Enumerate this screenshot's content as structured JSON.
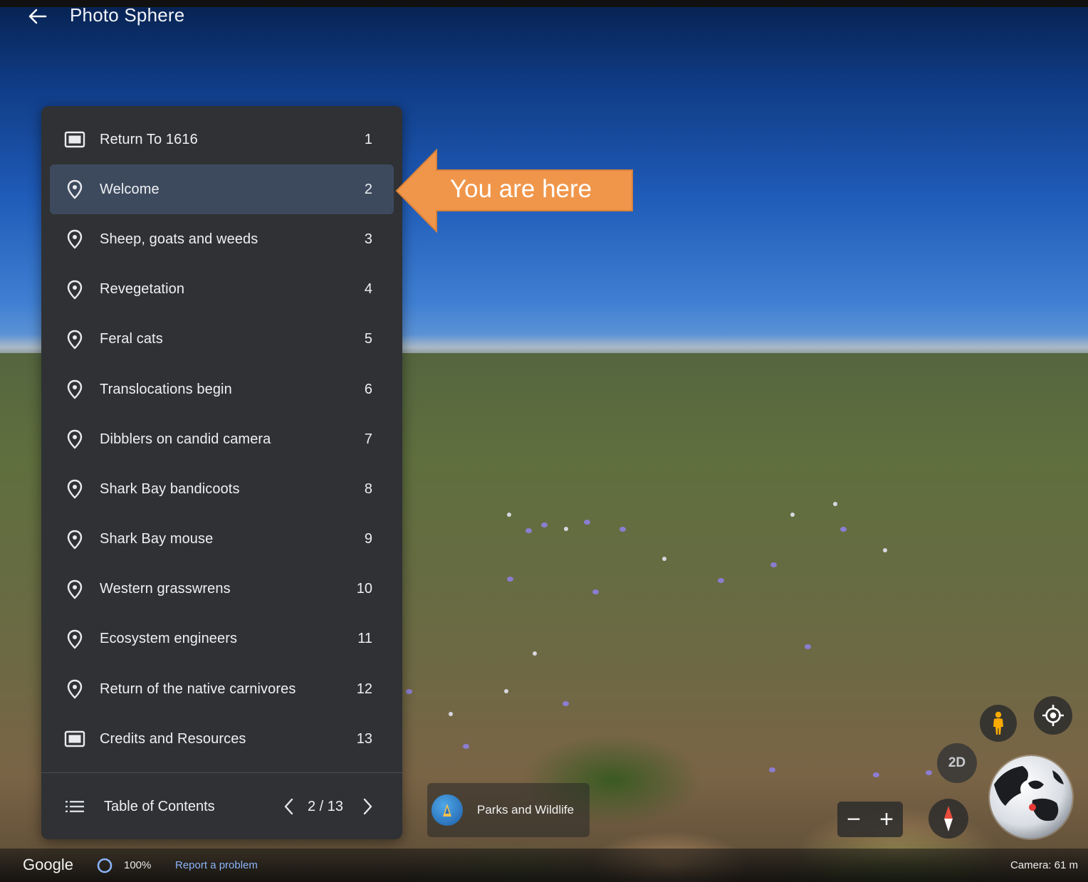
{
  "header": {
    "title": "Photo Sphere"
  },
  "toc": {
    "items": [
      {
        "label": "Return To 1616",
        "num": "1",
        "icon": "slide-icon",
        "active": false
      },
      {
        "label": "Welcome",
        "num": "2",
        "icon": "place-pin-icon",
        "active": true
      },
      {
        "label": "Sheep, goats and weeds",
        "num": "3",
        "icon": "place-pin-icon",
        "active": false
      },
      {
        "label": "Revegetation",
        "num": "4",
        "icon": "place-pin-icon",
        "active": false
      },
      {
        "label": "Feral cats",
        "num": "5",
        "icon": "place-pin-icon",
        "active": false
      },
      {
        "label": "Translocations begin",
        "num": "6",
        "icon": "place-pin-icon",
        "active": false
      },
      {
        "label": "Dibblers on candid camera",
        "num": "7",
        "icon": "place-pin-icon",
        "active": false
      },
      {
        "label": "Shark Bay bandicoots",
        "num": "8",
        "icon": "place-pin-icon",
        "active": false
      },
      {
        "label": "Shark Bay mouse",
        "num": "9",
        "icon": "place-pin-icon",
        "active": false
      },
      {
        "label": "Western grasswrens",
        "num": "10",
        "icon": "place-pin-icon",
        "active": false
      },
      {
        "label": "Ecosystem engineers",
        "num": "11",
        "icon": "place-pin-icon",
        "active": false
      },
      {
        "label": "Return of the native carnivores",
        "num": "12",
        "icon": "place-pin-icon",
        "active": false
      },
      {
        "label": "Credits and Resources",
        "num": "13",
        "icon": "slide-icon",
        "active": false
      }
    ],
    "footer": {
      "title": "Table of Contents",
      "pager": "2 / 13"
    }
  },
  "callout": {
    "text": "You are here",
    "color": "#f0964b"
  },
  "attribution": {
    "name": "Parks and Wildlife"
  },
  "controls": {
    "view_mode": "2D",
    "zoom_out": "−",
    "zoom_in": "+"
  },
  "status_bar": {
    "brand": "Google",
    "load_percent": "100%",
    "report_link": "Report a problem",
    "camera": "Camera: 61 m"
  },
  "colors": {
    "panel_bg": "#2f3134",
    "active_row": "#3d4a5e",
    "link": "#8ab4f8",
    "pegman": "#f9ab00"
  }
}
